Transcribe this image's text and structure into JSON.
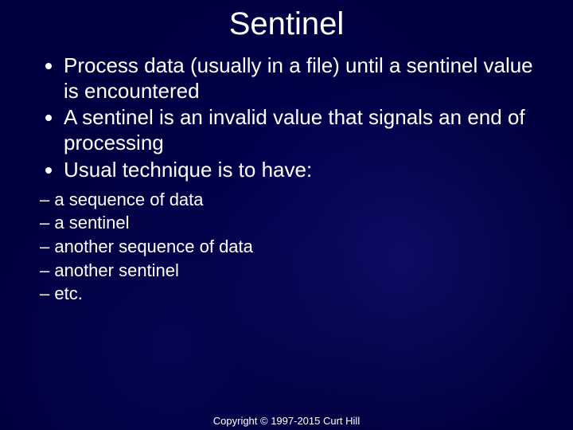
{
  "title": "Sentinel",
  "bullets": [
    "Process data (usually in a file) until a sentinel value is encountered",
    "A sentinel is an invalid value that signals an end of processing",
    "Usual technique is to have:"
  ],
  "dashes": [
    "a sequence of data",
    "a sentinel",
    "another sequence of data",
    "another sentinel",
    "etc."
  ],
  "footer": "Copyright © 1997-2015 Curt Hill"
}
